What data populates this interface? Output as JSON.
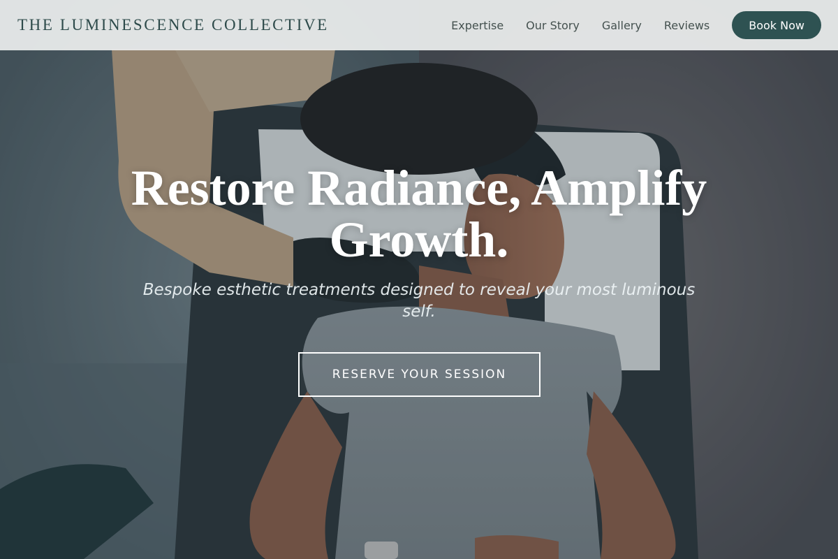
{
  "header": {
    "logo_text": "THE LUMINESCENCE COLLECTIVE",
    "nav": [
      {
        "label": "Expertise"
      },
      {
        "label": "Our Story"
      },
      {
        "label": "Gallery"
      },
      {
        "label": "Reviews"
      }
    ],
    "cta_label": "Book Now"
  },
  "hero": {
    "title": "Restore Radiance, Amplify Growth.",
    "subtitle": "Bespoke esthetic treatments designed to reveal your most luminous self.",
    "cta_label": "RESERVE YOUR SESSION",
    "background_image": "facial-treatment-photo"
  },
  "colors": {
    "brand": "#2e5252",
    "logo_text": "#2d4a4a",
    "header_bg": "#eceeee",
    "nav_text": "#44514f"
  }
}
